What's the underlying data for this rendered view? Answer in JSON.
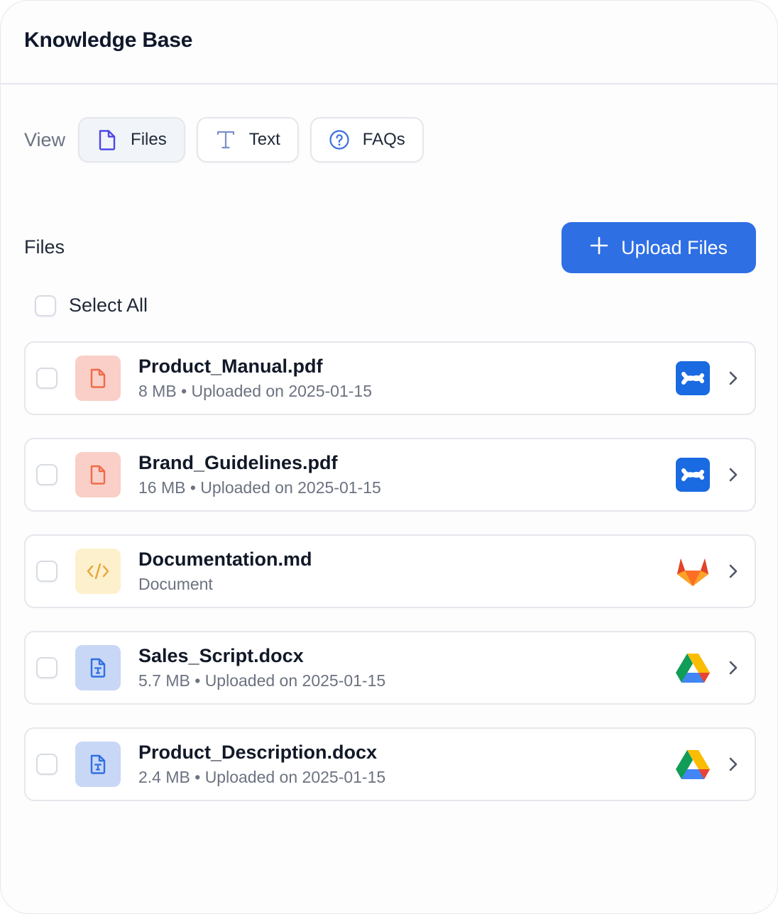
{
  "header": {
    "title": "Knowledge Base"
  },
  "view": {
    "label": "View",
    "buttons": [
      {
        "label": "Files",
        "icon": "file-icon",
        "active": true
      },
      {
        "label": "Text",
        "icon": "text-icon",
        "active": false
      },
      {
        "label": "FAQs",
        "icon": "question-circle-icon",
        "active": false
      }
    ]
  },
  "files_section": {
    "title": "Files",
    "upload_label": "Upload Files",
    "select_all_label": "Select All"
  },
  "files": [
    {
      "name": "Product_Manual.pdf",
      "meta": "8 MB • Uploaded on 2025-01-15",
      "type": "pdf",
      "source": "confluence-icon"
    },
    {
      "name": "Brand_Guidelines.pdf",
      "meta": "16 MB • Uploaded on 2025-01-15",
      "type": "pdf",
      "source": "confluence-icon"
    },
    {
      "name": "Documentation.md",
      "meta": "Document",
      "type": "md",
      "source": "gitlab-icon"
    },
    {
      "name": "Sales_Script.docx",
      "meta": "5.7 MB • Uploaded on 2025-01-15",
      "type": "docx",
      "source": "google-drive-icon"
    },
    {
      "name": "Product_Description.docx",
      "meta": "2.4 MB • Uploaded on 2025-01-15",
      "type": "docx",
      "source": "google-drive-icon"
    }
  ],
  "colors": {
    "accent": "#2f6fe4",
    "pdf_bg": "#f9cfc8",
    "pdf_fg": "#f06a48",
    "md_bg": "#fdf0cc",
    "md_fg": "#e9a33b",
    "docx_bg": "#c8d7f5",
    "docx_fg": "#2f6fe4",
    "confluence": "#1a6ae2"
  }
}
